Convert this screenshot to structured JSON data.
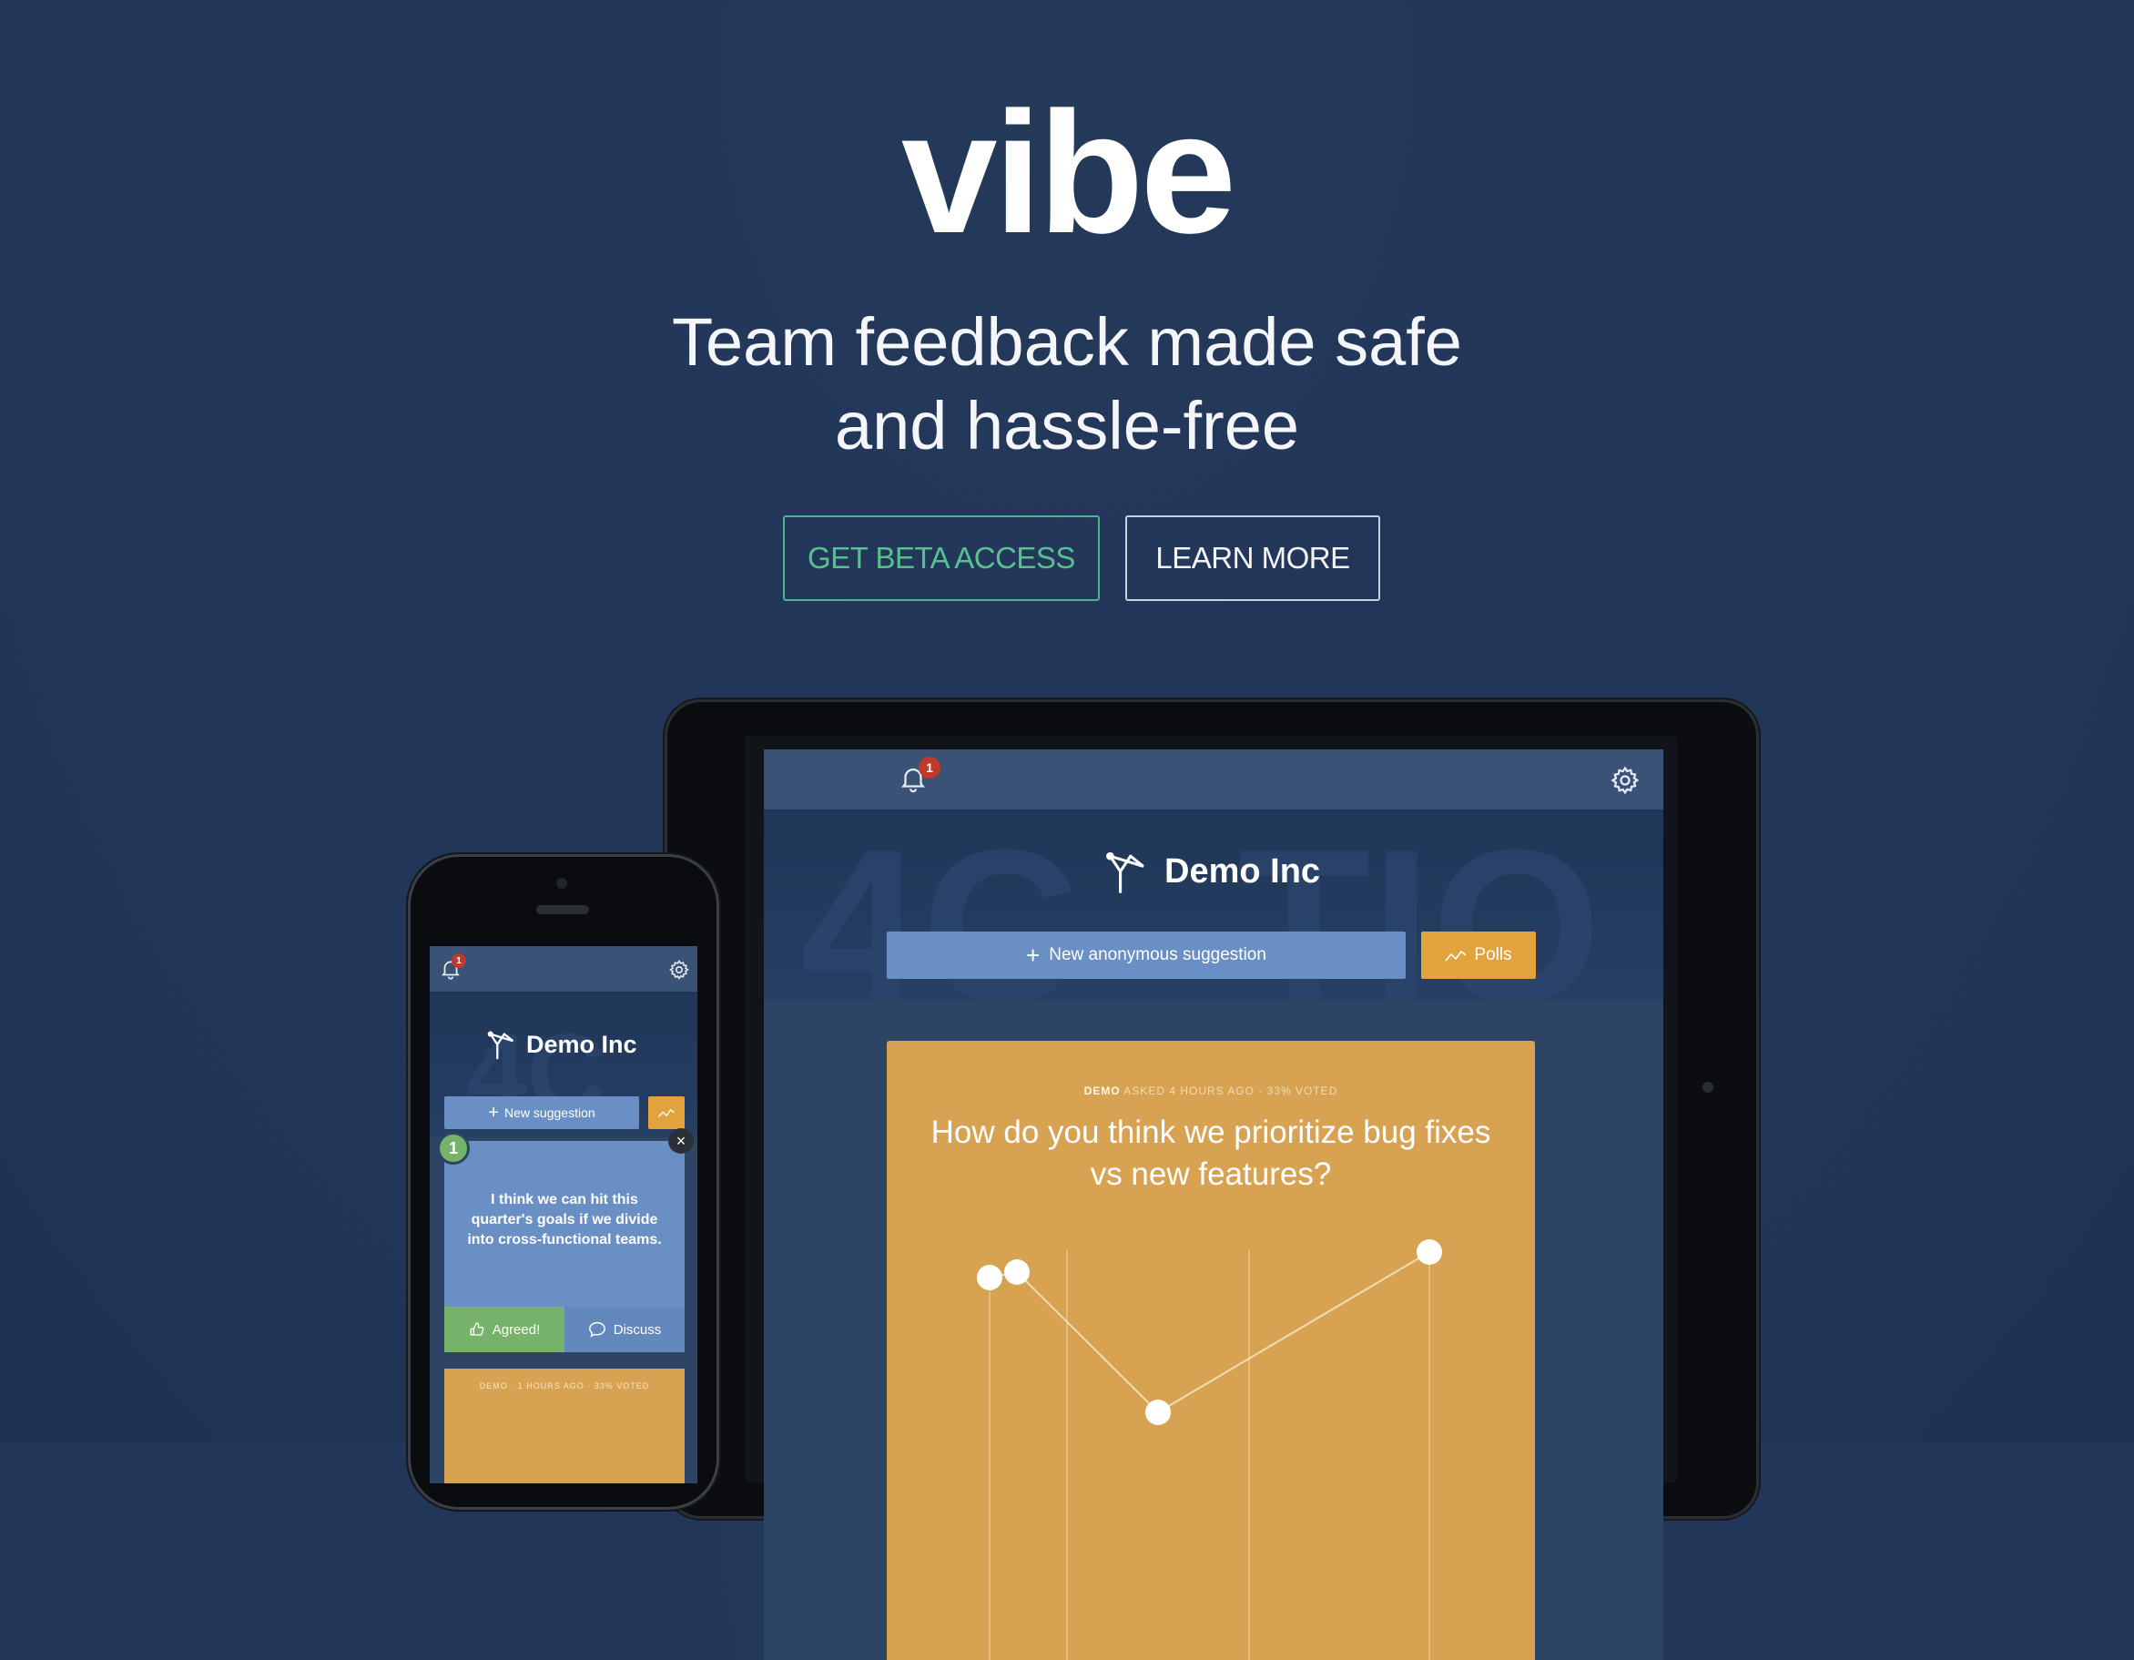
{
  "hero": {
    "logo": "vibe",
    "tagline_line1": "Team feedback made safe",
    "tagline_line2": "and hassle-free"
  },
  "cta": {
    "beta_label": "GET BETA ACCESS",
    "learn_label": "LEARN MORE"
  },
  "tablet": {
    "notification_count": "1",
    "company": "Demo Inc",
    "suggest_label": "New anonymous suggestion",
    "polls_label": "Polls",
    "poll": {
      "meta_user": "DEMO",
      "meta_rest": "ASKED 4 HOURS AGO · 33% VOTED",
      "question": "How do you think we prioritize bug fixes vs new features?"
    }
  },
  "phone": {
    "notification_count": "1",
    "company": "Demo Inc",
    "suggest_label": "New suggestion",
    "card_number": "1",
    "card_text": "I think we can hit this quarter's goals if we divide into cross-functional teams.",
    "agree_label": "Agreed!",
    "discuss_label": "Discuss",
    "close_symbol": "×",
    "poll_meta": "DEMO · 1 HOURS AGO · 33% VOTED"
  },
  "colors": {
    "accent_green": "#58c08f",
    "poll_orange": "#d7a353",
    "suggest_blue": "#6a8fc4"
  }
}
